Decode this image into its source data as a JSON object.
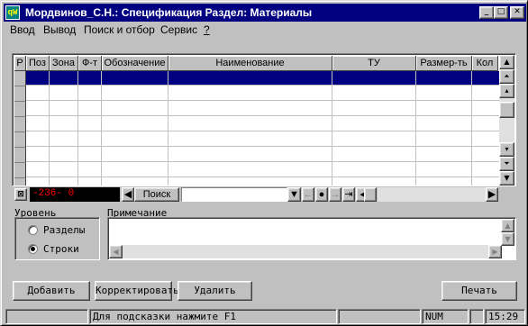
{
  "window": {
    "app_icon": "qW",
    "title": "Мордвинов_С.Н.: Спецификация Раздел: Материалы",
    "minimize_icon": "minimize-icon",
    "maximize_icon": "maximize-icon",
    "close_icon": "close-icon"
  },
  "menu": {
    "items": [
      "Ввод",
      "Вывод",
      "Поиск и отбор",
      "Сервис",
      "?"
    ]
  },
  "grid": {
    "columns": [
      "Р",
      "Поз",
      "Зона",
      "Ф-т",
      "Обозначение",
      "Наименование",
      "ТУ",
      "Размер-ть",
      "Кол"
    ],
    "selected_row_color": "#000080"
  },
  "nav": {
    "counter": "-236- 0",
    "search_label": "Поиск",
    "search_value": ""
  },
  "level": {
    "label": "Уровень",
    "options": [
      {
        "label": "Разделы",
        "selected": false
      },
      {
        "label": "Строки",
        "selected": true
      }
    ]
  },
  "note": {
    "label": "Примечание",
    "value": ""
  },
  "buttons": {
    "add": "Добавить",
    "edit": "Корректировать",
    "delete": "Удалить",
    "print": "Печать"
  },
  "status": {
    "hint": "Для подсказки нажмите F1",
    "num": "NUM",
    "time": "15:29"
  }
}
